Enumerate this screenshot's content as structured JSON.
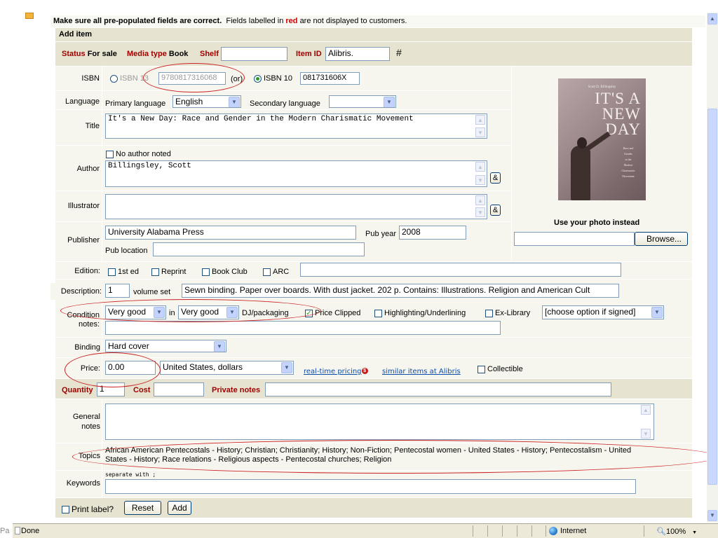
{
  "notice": {
    "bold": "Make sure all pre-populated fields are correct.",
    "text_a": "Fields labelled in",
    "text_red": "red",
    "text_b": "are not displayed to customers."
  },
  "form": {
    "header": "Add item",
    "status": {
      "label": "Status",
      "value": "For sale"
    },
    "media": {
      "label": "Media type",
      "value": "Book"
    },
    "shelf": {
      "label": "Shelf",
      "value": ""
    },
    "item_id": {
      "label": "Item ID",
      "value": "Alibris.",
      "hash": "#"
    },
    "isbn": {
      "label": "ISBN",
      "isbn13_label": "ISBN 13",
      "isbn13_value": "9780817316068",
      "or": "(or)",
      "isbn10_label": "ISBN 10",
      "isbn10_value": "081731606X"
    },
    "language": {
      "label": "Language",
      "primary_label": "Primary language",
      "primary_value": "English",
      "secondary_label": "Secondary language",
      "secondary_value": ""
    },
    "title": {
      "label": "Title",
      "value": "It's a New Day: Race and Gender in the Modern Charismatic Movement"
    },
    "author": {
      "label": "Author",
      "no_author": "No author noted",
      "value": "Billingsley, Scott",
      "amp": "&"
    },
    "illustrator": {
      "label": "Illustrator",
      "value": "",
      "amp": "&"
    },
    "publisher": {
      "label": "Publisher",
      "value": "University Alabama Press",
      "pub_year_label": "Pub year",
      "pub_year": "2008",
      "pub_location_label": "Pub location",
      "pub_location": ""
    },
    "edition": {
      "label": "Edition:",
      "options": [
        "1st ed",
        "Reprint",
        "Book Club",
        "ARC"
      ],
      "value": ""
    },
    "description": {
      "label": "Description:",
      "volumes": "1",
      "volume_label": "volume set",
      "value": "Sewn binding. Paper over boards. With dust jacket. 202 p. Contains: Illustrations. Religion and American Cult"
    },
    "condition": {
      "label_a": "Condition",
      "label_b": "notes:",
      "book": "Very good",
      "in": "in",
      "jacket": "Very good",
      "dj": "DJ/packaging",
      "checks": [
        "Price Clipped",
        "Highlighting/Underlining",
        "Ex-Library"
      ],
      "signed": "[choose option if signed]",
      "notes": ""
    },
    "binding": {
      "label": "Binding",
      "value": "Hard cover"
    },
    "price": {
      "label": "Price:",
      "value": "0.00",
      "currency": "United States, dollars",
      "realtime": "real-time pricing",
      "similar": "similar items at Alibris",
      "collectible": "Collectible"
    },
    "quantity": {
      "label": "Quantity",
      "value": "1",
      "cost_label": "Cost",
      "cost": "",
      "private_label": "Private notes",
      "private": ""
    },
    "general_notes": {
      "label_a": "General",
      "label_b": "notes",
      "value": ""
    },
    "topics": {
      "label": "Topics",
      "line1": "African American Pentecostals - History;  Christian;  Christianity;  History;  Non-Fiction;  Pentecostal women - United States - History;  Pentecostalism - United",
      "line2": "States - History;  Race relations - Religious aspects - Pentecostal churches;  Religion"
    },
    "keywords": {
      "label": "Keywords",
      "hint": "separate with ;",
      "value": ""
    },
    "footer": {
      "print_label": "Print label?",
      "reset": "Reset",
      "add": "Add"
    }
  },
  "cover": {
    "author": "Scott D. Billingsley",
    "title_l1": "IT'S A",
    "title_l2": "NEW",
    "title_l3": "DAY",
    "subtitle_l1": "Race and",
    "subtitle_l2": "Gender",
    "subtitle_l3": "in the",
    "subtitle_l4": "Modern",
    "subtitle_l5": "Charismatic",
    "subtitle_l6": "Movement",
    "photo_label": "Use your photo instead",
    "browse": "Browse..."
  },
  "statusbar": {
    "left_stub": "Pa",
    "status": "Done",
    "zone": "Internet",
    "zoom": "100%"
  }
}
